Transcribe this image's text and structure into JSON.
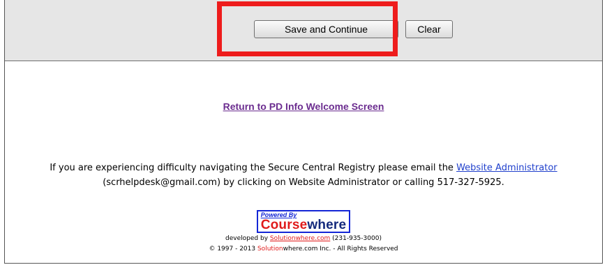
{
  "toolbar": {
    "save_label": "Save and Continue",
    "clear_label": "Clear"
  },
  "main": {
    "return_link": "Return to PD Info Welcome Screen",
    "help_line1_prefix": "If you are experiencing difficulty navigating the Secure Central Registry please email the",
    "admin_link": "Website Administrator",
    "help_line2": "(scrhelpdesk@gmail.com) by clicking on Website Administrator or calling 517-327-5925."
  },
  "footer": {
    "powered_by": "Powered By",
    "logo_part1": "Course",
    "logo_part2": "where",
    "developed_by": "developed by",
    "developer_link": "Solutionwhere.com",
    "developer_phone": "(231-935-3000)",
    "copyright_prefix": "© 1997 - 2013",
    "copyright_red": "Solution",
    "copyright_suffix": "where.com Inc. - All Rights Reserved"
  },
  "colors": {
    "highlight": "#ee1c1c",
    "visited_link": "#6b2c8f",
    "link": "#1f3fcc",
    "brand_red": "#e01b1b",
    "brand_navy": "#142a7c",
    "brand_blue": "#1326d6"
  }
}
